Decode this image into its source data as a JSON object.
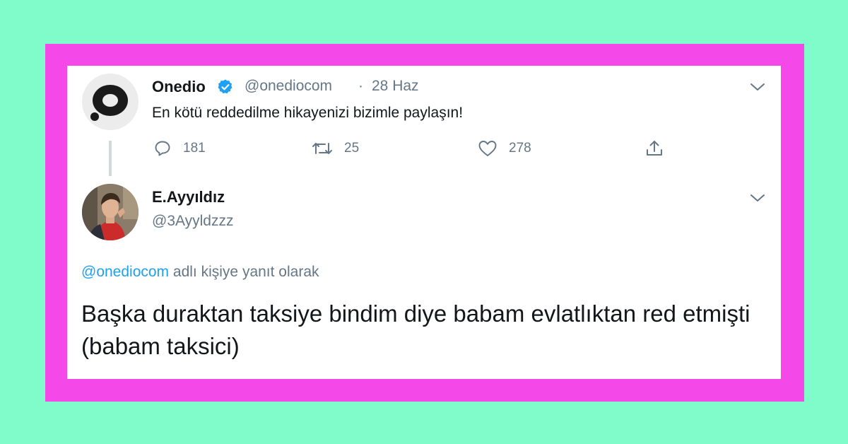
{
  "tweet1": {
    "name": "Onedio",
    "handle": "@onediocom",
    "separator": "·",
    "date": "28 Haz",
    "text": "En kötü reddedilme hikayenizi bizimle paylaşın!",
    "replies": "181",
    "retweets": "25",
    "likes": "278",
    "verified": true
  },
  "tweet2": {
    "name": "E.Ayyıldız",
    "handle": "@3Ayyldzzz",
    "reply_mention": "@onediocom",
    "reply_suffix": "adlı kişiye yanıt olarak",
    "text": "Başka duraktan taksiye bindim diye babam evlatlıktan red etmişti (babam taksici)"
  },
  "colors": {
    "background": "#7ffcc9",
    "frame": "#f548e9",
    "link": "#1da1f2",
    "secondary_text": "#657786",
    "verified": "#1da1f2"
  },
  "icons": [
    "onedio-logo-icon",
    "verified-badge-icon",
    "chevron-down-icon",
    "reply-icon",
    "retweet-icon",
    "like-icon",
    "share-icon"
  ]
}
